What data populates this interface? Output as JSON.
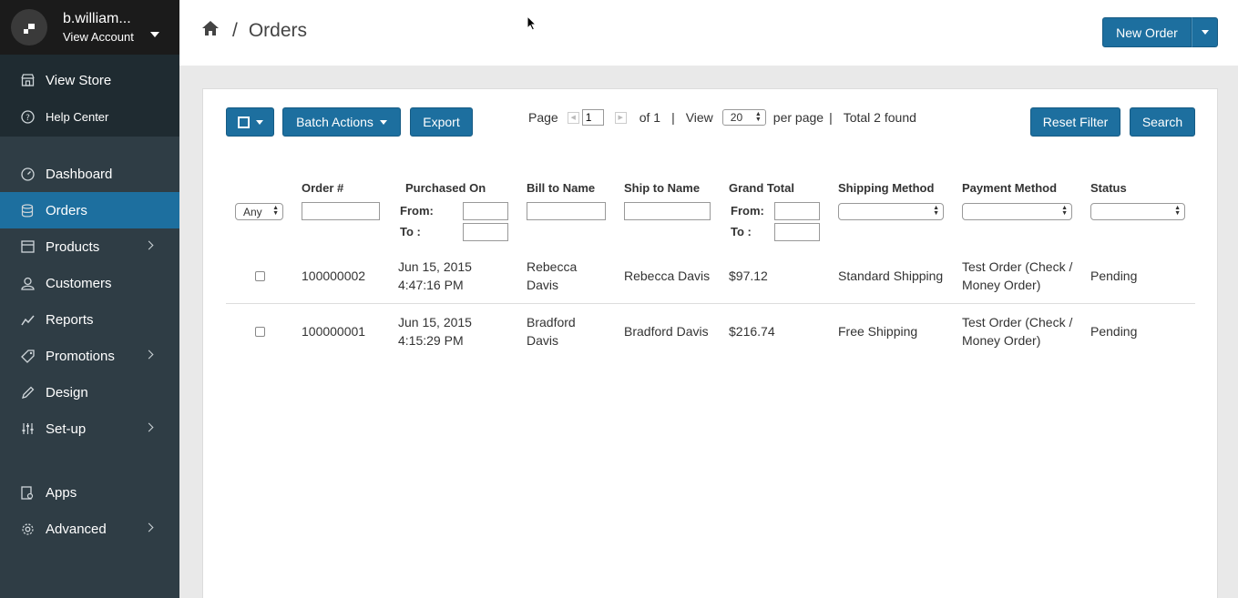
{
  "account": {
    "name": "b.william...",
    "sub": "View Account"
  },
  "store_links": [
    {
      "label": "View Store",
      "icon": "store-icon"
    },
    {
      "label": "Help Center",
      "icon": "help-icon"
    }
  ],
  "nav": [
    {
      "label": "Dashboard",
      "icon": "dashboard-icon",
      "chevron": false,
      "active": false
    },
    {
      "label": "Orders",
      "icon": "orders-icon",
      "chevron": false,
      "active": true
    },
    {
      "label": "Products",
      "icon": "products-icon",
      "chevron": true,
      "active": false
    },
    {
      "label": "Customers",
      "icon": "customers-icon",
      "chevron": false,
      "active": false
    },
    {
      "label": "Reports",
      "icon": "reports-icon",
      "chevron": false,
      "active": false
    },
    {
      "label": "Promotions",
      "icon": "tag-icon",
      "chevron": true,
      "active": false
    },
    {
      "label": "Design",
      "icon": "pencil-icon",
      "chevron": false,
      "active": false
    },
    {
      "label": "Set-up",
      "icon": "sliders-icon",
      "chevron": true,
      "active": false
    }
  ],
  "nav_bottom": [
    {
      "label": "Apps",
      "icon": "apps-icon",
      "chevron": false
    },
    {
      "label": "Advanced",
      "icon": "gear-icon",
      "chevron": true
    }
  ],
  "breadcrumb": {
    "sep": "/",
    "title": "Orders"
  },
  "header": {
    "new_order_label": "New Order"
  },
  "toolbar": {
    "batch_label": "Batch Actions",
    "export_label": "Export",
    "reset_label": "Reset Filter",
    "search_label": "Search"
  },
  "pager": {
    "page_label": "Page",
    "page_value": "1",
    "of_label": "of 1",
    "view_label": "View",
    "view_value": "20",
    "per_page_label": "per page",
    "total_label": "Total 2 found"
  },
  "columns": {
    "order": "Order #",
    "purchased": "Purchased On",
    "bill": "Bill to Name",
    "ship": "Ship to Name",
    "total": "Grand Total",
    "shipping": "Shipping Method",
    "payment": "Payment Method",
    "status": "Status"
  },
  "filters": {
    "any_value": "Any",
    "from_label": "From:",
    "to_label": "To :"
  },
  "rows": [
    {
      "order": "100000002",
      "date": "Jun 15, 2015",
      "time": "4:47:16 PM",
      "bill_first": "Rebecca",
      "bill_last": "Davis",
      "ship": "Rebecca Davis",
      "total": "$97.12",
      "shipping": "Standard Shipping",
      "payment_1": "Test Order (Check /",
      "payment_2": "Money Order)",
      "status": "Pending"
    },
    {
      "order": "100000001",
      "date": "Jun 15, 2015",
      "time": "4:15:29 PM",
      "bill_first": "Bradford",
      "bill_last": "Davis",
      "ship": "Bradford Davis",
      "total": "$216.74",
      "shipping": "Free Shipping",
      "payment_1": "Test Order (Check /",
      "payment_2": "Money Order)",
      "status": "Pending"
    }
  ],
  "colors": {
    "accent": "#1d6f9f",
    "sidebar": "#2f3d45",
    "account_bar": "#1b1b1b"
  }
}
